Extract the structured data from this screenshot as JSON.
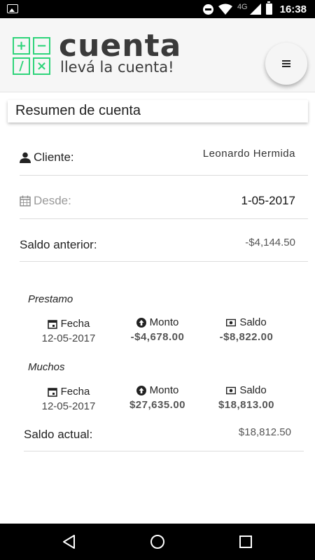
{
  "statusbar": {
    "network": "4G",
    "time": "16:38"
  },
  "header": {
    "logo": {
      "symbols": [
        "+",
        "−",
        "/",
        "×"
      ],
      "title": "cuenta",
      "tagline": "llevá la cuenta!"
    },
    "brand_color": "#2ed47a",
    "menu_icon": "hamburger-icon"
  },
  "section_title": "Resumen de cuenta",
  "cliente": {
    "label": "Cliente:",
    "value": "Leonardo Hermida",
    "icon": "person-icon"
  },
  "desde": {
    "label": "Desde:",
    "value": "1-05-2017",
    "icon": "calendar-icon"
  },
  "saldo_anterior": {
    "label": "Saldo anterior:",
    "value": "-$4,144.50"
  },
  "movimientos": [
    {
      "title": "Prestamo",
      "fecha_label": "Fecha",
      "fecha": "12-05-2017",
      "monto_label": "Monto",
      "monto": "-$4,678.00",
      "saldo_label": "Saldo",
      "saldo": "-$8,822.00"
    },
    {
      "title": "Muchos",
      "fecha_label": "Fecha",
      "fecha": "12-05-2017",
      "monto_label": "Monto",
      "monto": "$27,635.00",
      "saldo_label": "Saldo",
      "saldo": "$18,813.00"
    }
  ],
  "saldo_actual": {
    "label": "Saldo actual:",
    "value": "$18,812.50"
  },
  "navbar": {
    "buttons": [
      "back-icon",
      "home-icon",
      "recents-icon"
    ]
  }
}
